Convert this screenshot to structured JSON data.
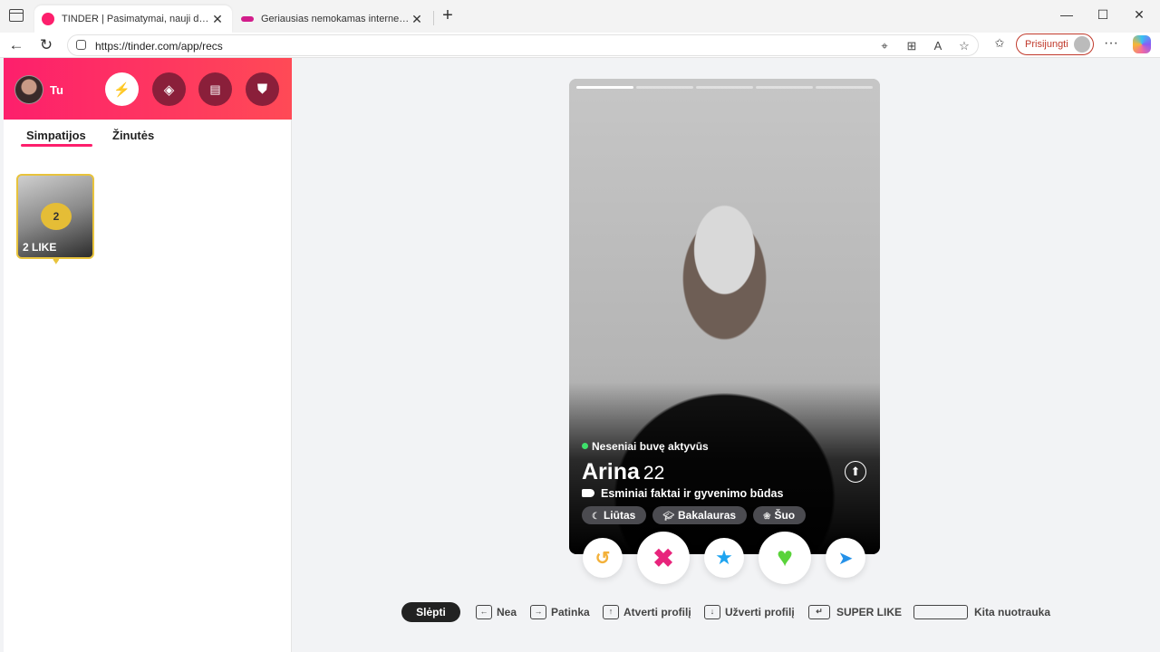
{
  "browser": {
    "tabs": [
      {
        "title": "TINDER | Pasimatymai, nauji draugai",
        "active": true,
        "favicon_color": "#fd1f6c"
      },
      {
        "title": "Geriausias nemokamas internetinis",
        "active": false,
        "favicon_color": "#d21d8b"
      }
    ],
    "url": "https://tinder.com/app/recs",
    "signin_label": "Prisijungti"
  },
  "sidebar": {
    "user_name": "Tu",
    "tabs": [
      "Simpatijos",
      "Žinutės"
    ],
    "likes": {
      "count": "2",
      "label": "2 LIKE"
    }
  },
  "profile": {
    "status": "Neseniai buvę aktyvūs",
    "name": "Arina",
    "age": "22",
    "facts_title": "Esminiai faktai ir gyvenimo būdas",
    "chips": [
      {
        "icon": "moon-icon",
        "label": "Liūtas"
      },
      {
        "icon": "graduation-cap-icon",
        "label": "Bakalauras"
      },
      {
        "icon": "paw-icon",
        "label": "Šuo"
      }
    ],
    "photo_count": 5,
    "current_photo": 1
  },
  "hints": {
    "hide": "Slėpti",
    "nope": "Nea",
    "like": "Patinka",
    "open_profile": "Atverti profilį",
    "close_profile": "Užverti profilį",
    "super_like": "SUPER LIKE",
    "next_photo": "Kita nuotrauka"
  },
  "colors": {
    "brand": "#fd1f6c",
    "gold": "#e5bd36",
    "nope": "#e8247c",
    "superlike": "#1ea4f0",
    "like": "#59d33a",
    "boost": "#2591e8",
    "rewind": "#f3b13a"
  }
}
